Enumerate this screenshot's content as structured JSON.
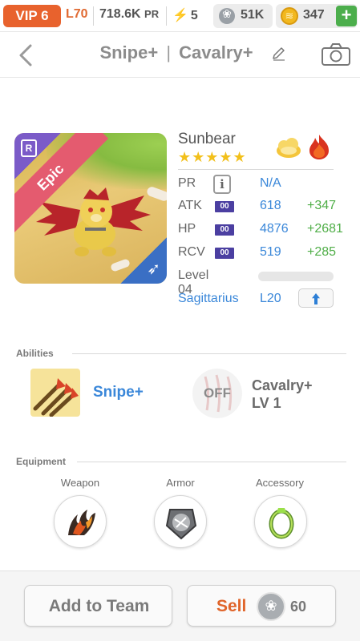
{
  "status_bar": {
    "vip": "VIP 6",
    "level": "L70",
    "power": "718.6K",
    "power_unit": "PR",
    "energy": "5",
    "paws": "51K",
    "coins": "347",
    "add_label": "+"
  },
  "header": {
    "title_left": "Snipe",
    "title_sep": "|",
    "title_right": "Cavalry",
    "plus_symbol": "+"
  },
  "monster": {
    "name": "Sunbear",
    "rarity": "Epic",
    "rank_badge": "R",
    "stars": "★★★★★",
    "star_count": 5,
    "elements": [
      "light-element-icon",
      "fire-element-icon"
    ],
    "stats": {
      "pr": {
        "label": "PR",
        "value": "N/A"
      },
      "atk": {
        "label": "ATK",
        "tag": "00",
        "value": "618",
        "bonus": "+347"
      },
      "hp": {
        "label": "HP",
        "tag": "00",
        "value": "4876",
        "bonus": "+2681"
      },
      "rcv": {
        "label": "RCV",
        "tag": "00",
        "value": "519",
        "bonus": "+285"
      }
    },
    "level": "Level 04",
    "xp_progress": 0.0,
    "zodiac": "Sagittarius",
    "zodiac_level": "L20"
  },
  "abilities": {
    "heading": "Abilities",
    "primary": {
      "name": "Snipe+"
    },
    "secondary": {
      "status": "OFF",
      "name": "Cavalry+",
      "level": "LV 1"
    }
  },
  "equipment": {
    "heading": "Equipment",
    "slots": [
      {
        "label": "Weapon",
        "icon": "weapon-claw-icon"
      },
      {
        "label": "Armor",
        "icon": "armor-shield-icon"
      },
      {
        "label": "Accessory",
        "icon": "accessory-ring-icon"
      }
    ]
  },
  "footer": {
    "add_label": "Add to Team",
    "sell_label": "Sell",
    "sell_amount": "60"
  },
  "colors": {
    "orange": "#e8622d",
    "blue": "#3a87d9",
    "green": "#4fae47",
    "epic": "#e45b6f",
    "star": "#f2c01b"
  }
}
